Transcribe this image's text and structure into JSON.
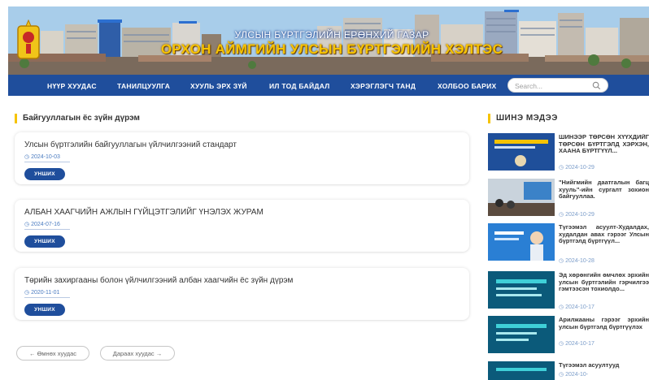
{
  "header": {
    "subtitle": "УЛСЫН БҮРТГЭЛИЙН ЕРӨНХИЙ ГАЗАР",
    "title": "ОРХОН АЙМГИЙН УЛСЫН БҮРТГЭЛИЙН ХЭЛТЭС"
  },
  "nav": {
    "items": [
      "НҮҮР ХУУДАС",
      "ТАНИЛЦУУЛГА",
      "ХУУЛЬ ЭРХ ЗҮЙ",
      "ИЛ ТОД БАЙДАЛ",
      "ХЭРЭГЛЭГЧ ТАНД",
      "ХОЛБОО БАРИХ"
    ],
    "search_placeholder": "Search..."
  },
  "main": {
    "heading": "Байгууллагын ёс зүйн дүрэм",
    "read_label": "УНШИХ",
    "cards": [
      {
        "title": "Улсын бүртгэлийн байгууллагын үйлчилгээний стандарт",
        "date": "2024-10-03"
      },
      {
        "title": "АЛБАН ХААГЧИЙН АЖЛЫН ГҮЙЦЭТГЭЛИЙГ ҮНЭЛЭХ ЖУРАМ",
        "date": "2024-07-16"
      },
      {
        "title": "Төрийн захиргааны болон үйлчилгээний албан хаагчийн ёс зүйн дүрэм",
        "date": "2020-11-01"
      }
    ],
    "pager": {
      "prev": "← Өмнөх хуудас",
      "next": "Дараах хуудас →"
    }
  },
  "sidebar": {
    "heading": "ШИНЭ МЭДЭЭ",
    "news": [
      {
        "text": "ШИНЭЭР ТӨРСӨН ХҮҮХДИЙГ ТӨРСӨН БҮРТГЭЛД ХЭРХЭН, ХААНА БҮРТГҮҮЛ...",
        "date": "2024-10-29"
      },
      {
        "text": "\"Нийгмийн даатгалын багц хууль\"-ийн сургалт зохион байгууллаа.",
        "date": "2024-10-29"
      },
      {
        "text": "Түгээмэл асуулт-Худалдах, худалдан авах гэрээг Улсын бүртгэлд бүртгүүл...",
        "date": "2024-10-28"
      },
      {
        "text": "Эд хөрөнгийн өмчлөх эрхийн улсын бүртгэлийн гэрчилгээ гэмтээсэн тохиолдо...",
        "date": "2024-10-17"
      },
      {
        "text": "Арилжааны гэрээг эрхийн улсын бүртгэлд бүртгүүлэх",
        "date": "2024-10-17"
      },
      {
        "text": "Түгээмэл асуултууд",
        "date": "2024-10-"
      }
    ]
  },
  "colors": {
    "navy": "#1f4e9c",
    "accent": "#f6c300",
    "date_blue": "#4a7bc0"
  }
}
